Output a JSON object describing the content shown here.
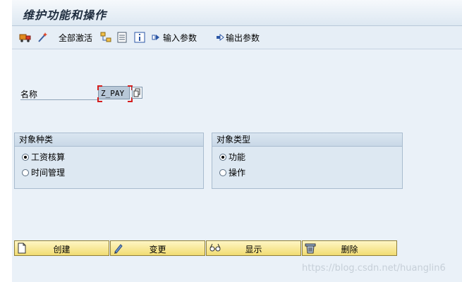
{
  "window": {
    "title": "维护功能和操作"
  },
  "toolbar": {
    "activate_all": "全部激活",
    "input_params": "输入参数",
    "output_params": "输出参数"
  },
  "form": {
    "name_label": "名称",
    "name_value": "Z_PAY"
  },
  "object_kind": {
    "header": "对象种类",
    "options": [
      "工资核算",
      "时间管理"
    ],
    "selected": "工资核算"
  },
  "object_type": {
    "header": "对象类型",
    "options": [
      "功能",
      "操作"
    ],
    "selected": "功能"
  },
  "buttons": {
    "create": "创建",
    "change": "变更",
    "display": "显示",
    "delete": "删除"
  },
  "watermark": "https://blog.csdn.net/huanglin6",
  "colors": {
    "background": "#eaf1f8",
    "button": "#f1dc72",
    "group_header": "#c9d8e7",
    "required_marker": "#d41e1e"
  }
}
